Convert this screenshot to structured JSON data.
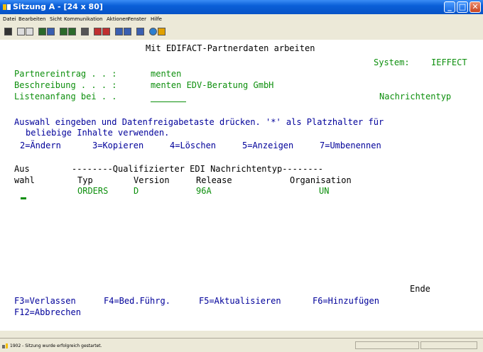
{
  "window": {
    "title": "Sitzung A - [24 x 80]",
    "controls": {
      "minimize": "_",
      "maximize": "□",
      "close": "✕"
    }
  },
  "menu": [
    "Datei",
    "Bearbeiten",
    "Sicht",
    "Kommunikation",
    "Aktionen",
    "Fenster",
    "Hilfe"
  ],
  "screen": {
    "heading": "Mit EDIFACT-Partnerdaten arbeiten",
    "system_label": "System:",
    "system_value": "IEFFECT",
    "partner_label": "Partnereintrag . . :",
    "partner_value": "menten",
    "desc_label": "Beschreibung . . . :",
    "desc_value": "menten EDV-Beratung GmbH",
    "list_label": "Listenanfang bei . .",
    "list_value": "",
    "list_right": "Nachrichtentyp",
    "instr_1": "Auswahl eingeben und Datenfreigabetaste drücken. '*' als Platzhalter für",
    "instr_2": "beliebige Inhalte verwenden.",
    "options": [
      "2=Ändern",
      "3=Kopieren",
      "4=Löschen",
      "5=Anzeigen",
      "7=Umbenennen"
    ],
    "col_aus": "Aus",
    "col_group": "--------Qualifizierter EDI Nachrichtentyp--------",
    "col_wahl": "wahl",
    "columns": [
      "Typ",
      "Version",
      "Release",
      "Organisation"
    ],
    "rows": [
      {
        "typ": "ORDERS",
        "version": "D",
        "release": "96A",
        "organisation": "UN"
      }
    ],
    "end_text": "Ende",
    "fkeys_1": [
      "F3=Verlassen",
      "F4=Bed.Führg.",
      "F5=Aktualisieren",
      "F6=Hinzufügen"
    ],
    "fkeys_2": [
      "F12=Abbrechen"
    ]
  },
  "status": {
    "text": "1902 - Sitzung wurde erfolgreich gestartet."
  },
  "colors": {
    "titlebar": "#0a5fd8",
    "screen_bg": "#ffffff",
    "field_green": "#0d8f0d",
    "text_blue": "#00009a"
  }
}
